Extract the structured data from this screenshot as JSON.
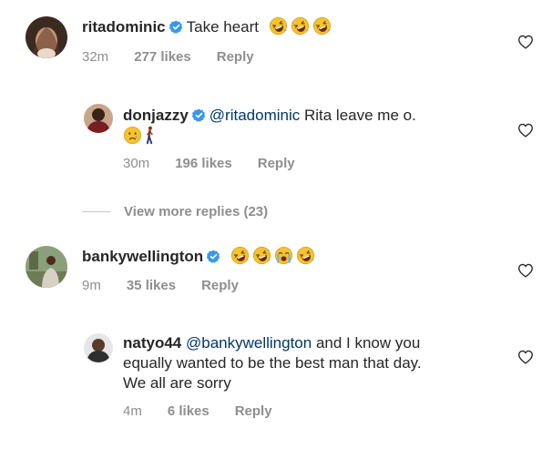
{
  "comments": [
    {
      "username": "ritadominic",
      "text": "Take heart",
      "emojis": [
        "rofl-emoji",
        "rofl-emoji",
        "rofl-emoji"
      ],
      "time": "32m",
      "likes": "277 likes",
      "reply": "Reply"
    },
    {
      "username": "donjazzy",
      "mention": "@ritadominic",
      "text": " Rita leave me o.",
      "emojis": [
        "crying-face-emoji",
        "person-walking-emoji"
      ],
      "time": "30m",
      "likes": "196 likes",
      "reply": "Reply"
    },
    {
      "username": "bankywellington",
      "text": "",
      "emojis": [
        "rofl-emoji",
        "rofl-emoji",
        "loudly-crying-emoji",
        "rofl-emoji"
      ],
      "time": "9m",
      "likes": "35 likes",
      "reply": "Reply"
    },
    {
      "username": "natyo44",
      "mention": "@bankywellington",
      "text_line1": " and I know you",
      "text_line2": "equally wanted to be the best man that day.",
      "text_line3": "We all are sorry",
      "time": "4m",
      "likes": "6 likes",
      "reply": "Reply"
    }
  ],
  "view_more": "View more replies (23)",
  "colors": {
    "verified": "#3897f0",
    "meta": "#8e8e8e",
    "mention": "#00376b",
    "emoji_face": "#f7c22c"
  }
}
